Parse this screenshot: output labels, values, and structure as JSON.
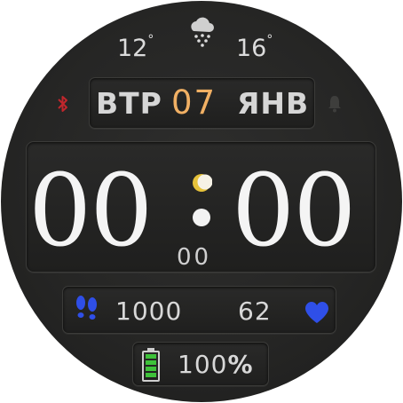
{
  "weather": {
    "icon": "snow-cloud-icon",
    "temp_low": "12",
    "temp_high": "16",
    "degree": "°"
  },
  "date": {
    "day_of_week": "ВТР",
    "day": "07",
    "month": "ЯНВ"
  },
  "status": {
    "bluetooth_icon": "bluetooth-icon",
    "alarm_icon": "bell-icon"
  },
  "time": {
    "hours": "00",
    "minutes": "00",
    "seconds": "00",
    "moon_icon": "moon-phase-icon"
  },
  "activity": {
    "steps": "1000",
    "heart_rate": "62",
    "steps_icon": "footprints-icon",
    "heart_icon": "heart-icon"
  },
  "battery": {
    "level": "100",
    "percent_sign": "%",
    "icon": "battery-icon"
  },
  "colors": {
    "accent_date": "#f1b064",
    "bluetooth": "#c0262c",
    "steps_blue": "#2f4fe8",
    "battery_green": "#3ec23a"
  }
}
